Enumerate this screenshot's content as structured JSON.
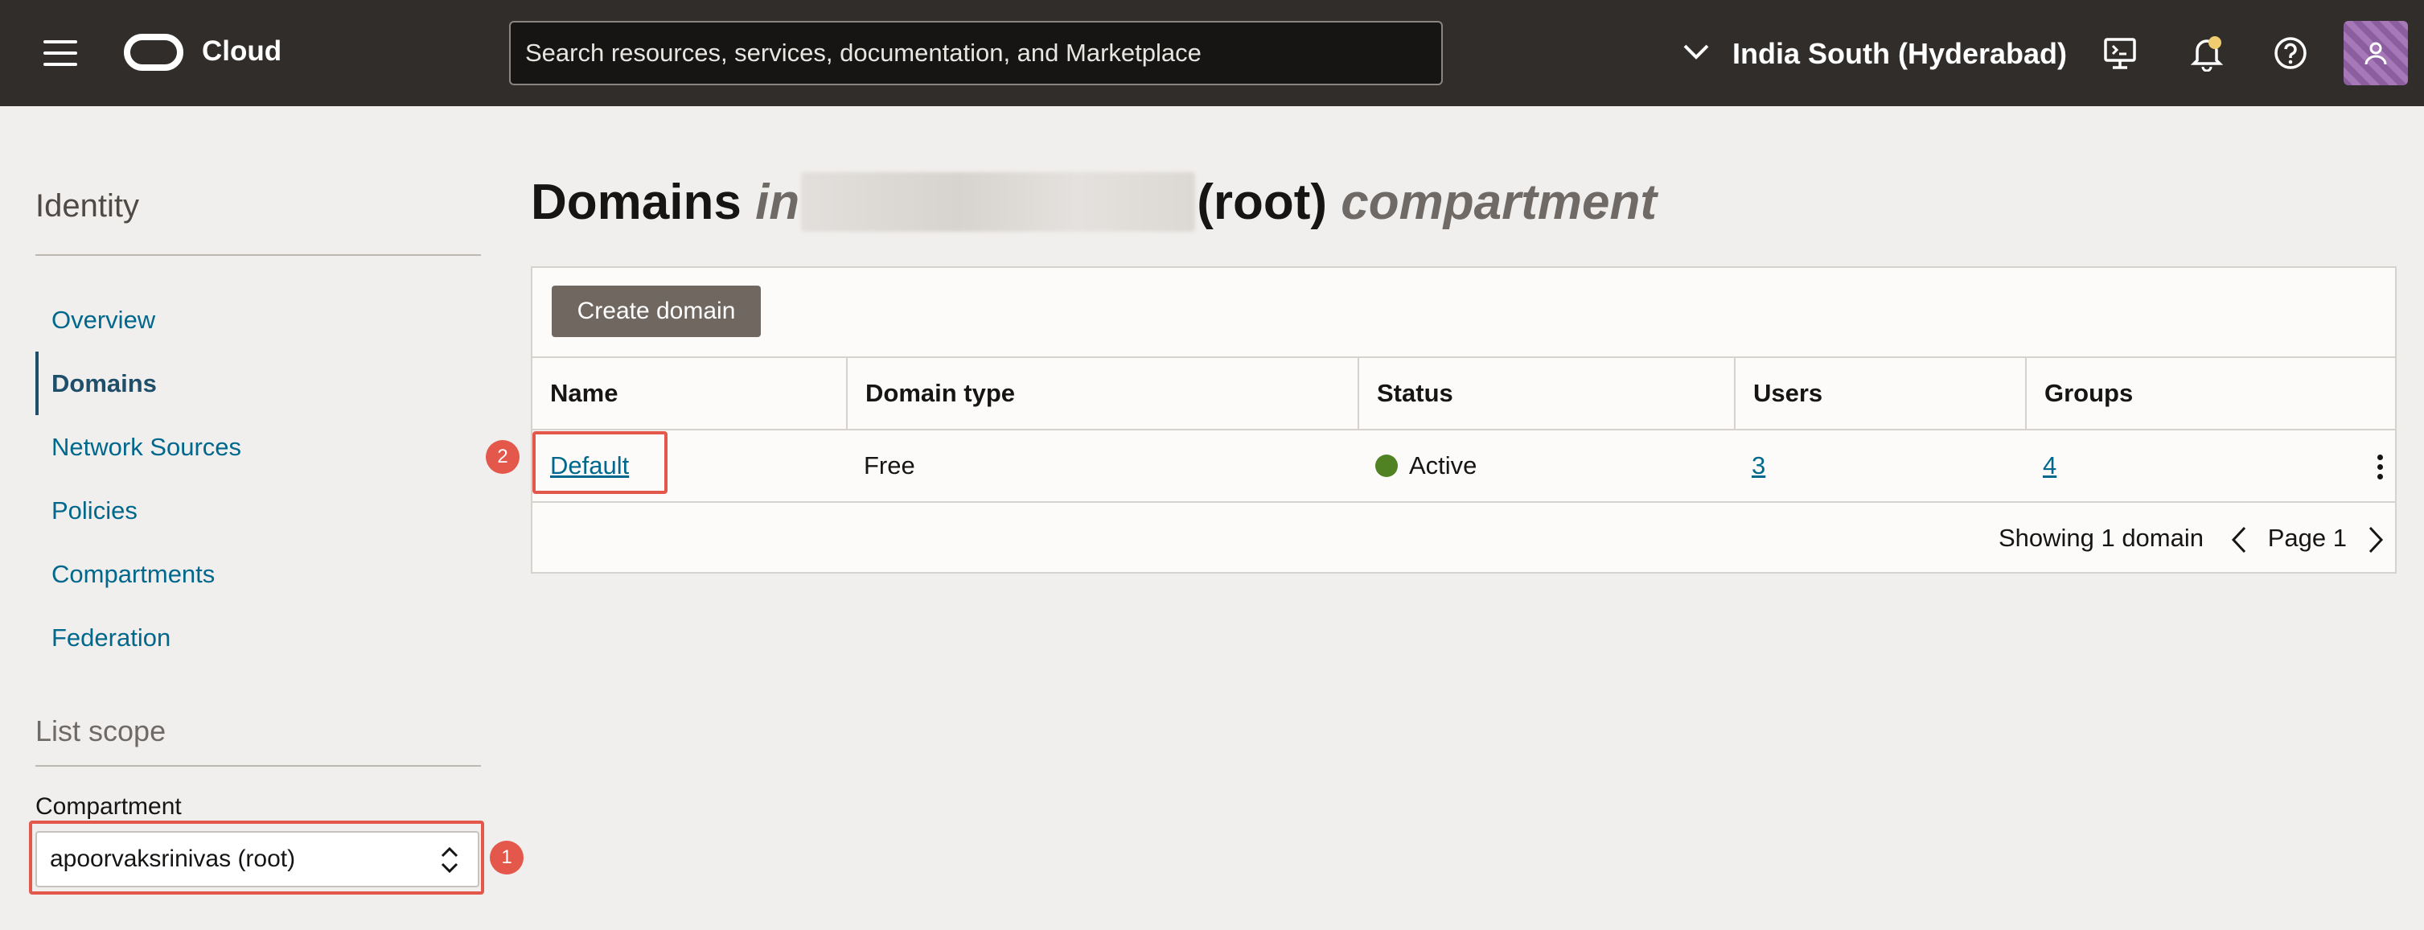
{
  "header": {
    "brand": "Cloud",
    "search_placeholder": "Search resources, services, documentation, and Marketplace",
    "region": "India South (Hyderabad)"
  },
  "icons": {
    "menu": "hamburger-menu-icon",
    "logo": "oracle-logo-icon",
    "region_toggle": "chevron-down-icon",
    "cloud_shell": "cloud-shell-icon",
    "notifications": "bell-icon",
    "help": "help-icon",
    "profile": "user-icon",
    "compartment_toggle": "chevron-up-down-icon",
    "row_actions": "kebab-menu-icon",
    "prev_page": "chevron-left-icon",
    "next_page": "chevron-right-icon"
  },
  "sidebar": {
    "title": "Identity",
    "items": [
      {
        "label": "Overview",
        "active": false
      },
      {
        "label": "Domains",
        "active": true
      },
      {
        "label": "Network Sources",
        "active": false
      },
      {
        "label": "Policies",
        "active": false
      },
      {
        "label": "Compartments",
        "active": false
      },
      {
        "label": "Federation",
        "active": false
      }
    ],
    "scope_title": "List scope",
    "compartment_label": "Compartment",
    "compartment_value": "apoorvaksrinivas (root)"
  },
  "main": {
    "title_main": "Domains",
    "title_in": "in",
    "title_root": "(root)",
    "title_suffix": "compartment",
    "create_button": "Create domain",
    "columns": [
      "Name",
      "Domain type",
      "Status",
      "Users",
      "Groups"
    ],
    "rows": [
      {
        "name": "Default",
        "type": "Free",
        "status": "Active",
        "users": "3",
        "groups": "4"
      }
    ],
    "showing": "Showing 1 domain",
    "page": "Page 1"
  },
  "annotations": [
    "1",
    "2"
  ],
  "colors": {
    "topbar": "#312d2a",
    "link": "#00688c",
    "active_status": "#508223",
    "highlight": "#e4574b",
    "button": "#6f6760"
  }
}
